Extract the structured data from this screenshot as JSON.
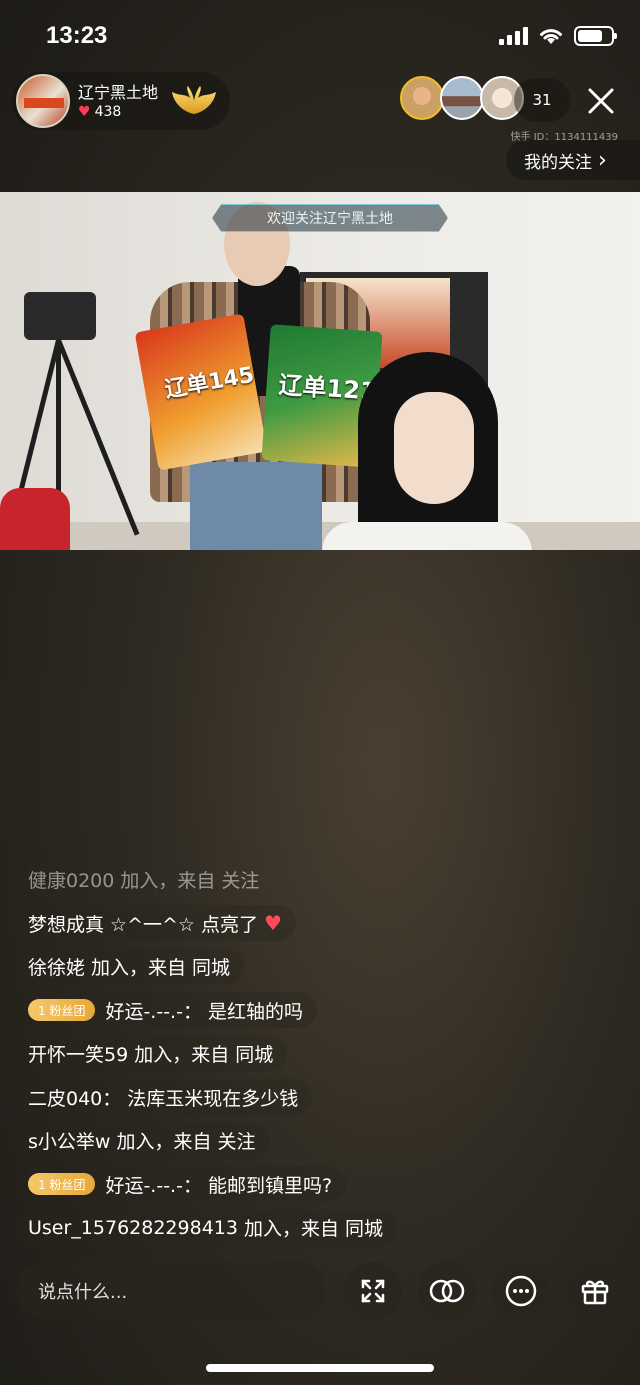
{
  "status_bar": {
    "time": "13:23"
  },
  "host": {
    "name": "辽宁黑土地",
    "likes": "438",
    "avatar_icon": "host-avatar",
    "badge_icon": "gold-wings-icon"
  },
  "viewers": {
    "count": "31",
    "kuaishou_id": "快手 ID：1134111439"
  },
  "follow_button": {
    "label": "我的关注",
    "chevron": "›"
  },
  "video": {
    "banner_text": "欢迎关注辽宁黑土地",
    "bag1_text": "辽单145",
    "bag2_text": "辽单121"
  },
  "comments": [
    {
      "type": "join",
      "faded": true,
      "name": "健康0200",
      "text": "加入，来自 关注"
    },
    {
      "type": "light",
      "name": "梦想成真 ☆^一^☆",
      "text": "点亮了"
    },
    {
      "type": "join",
      "name": "徐徐姥",
      "text": "加入，来自 同城"
    },
    {
      "type": "msg",
      "badge": "1 粉丝团",
      "name": "好运-.--.-：",
      "text": "是红轴的吗"
    },
    {
      "type": "join",
      "name": "开怀一笑59",
      "text": "加入，来自 同城"
    },
    {
      "type": "msg",
      "name": "二皮040：",
      "text": "法库玉米现在多少钱"
    },
    {
      "type": "join",
      "name": "s小公举w",
      "text": "加入，来自 关注"
    },
    {
      "type": "msg",
      "badge": "1 粉丝团",
      "name": "好运-.--.-：",
      "text": "能邮到镇里吗?"
    },
    {
      "type": "join",
      "name": "User_1576282298413",
      "text": "加入，来自 同城"
    }
  ],
  "bottom_bar": {
    "input_placeholder": "说点什么...",
    "tools": [
      "fullscreen-icon",
      "link-circles-icon",
      "more-icon",
      "gift-icon"
    ]
  }
}
